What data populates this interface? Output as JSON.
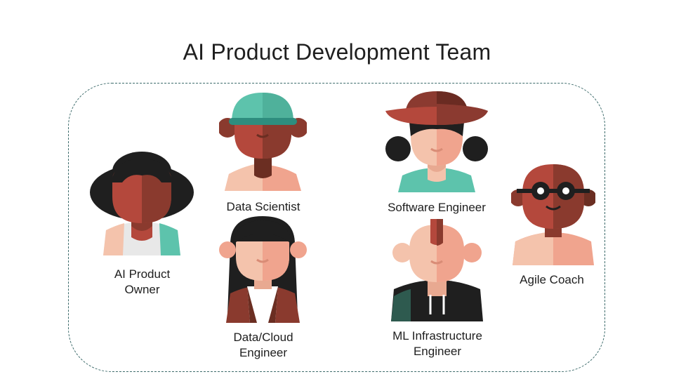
{
  "title": "AI Product Development Team",
  "team": {
    "members": [
      {
        "id": "ai-product-owner",
        "label_lines": [
          "AI Product",
          "Owner"
        ],
        "icon": "woman-bun-avatar-icon"
      },
      {
        "id": "data-scientist",
        "label_lines": [
          "Data Scientist"
        ],
        "icon": "cap-avatar-icon"
      },
      {
        "id": "data-cloud-engineer",
        "label_lines": [
          "Data/Cloud",
          "Engineer"
        ],
        "icon": "long-hair-avatar-icon"
      },
      {
        "id": "software-engineer",
        "label_lines": [
          "Software Engineer"
        ],
        "icon": "sun-hat-avatar-icon"
      },
      {
        "id": "ml-infrastructure-engineer",
        "label_lines": [
          "ML Infrastructure",
          "Engineer"
        ],
        "icon": "mohawk-avatar-icon"
      },
      {
        "id": "agile-coach",
        "label_lines": [
          "Agile Coach"
        ],
        "icon": "bald-glasses-avatar-icon"
      }
    ]
  },
  "colors": {
    "skin_light": "#f4c3ac",
    "skin_light_dark": "#e8a991",
    "skin_medium": "#b4483c",
    "skin_medium_dark": "#8a3a2e",
    "skin_dark_shadow": "#6b2e22",
    "hair_black": "#1f1f1f",
    "teal": "#5dc3ac",
    "teal_dark": "#2e8d7e",
    "salmon": "#f0a48e",
    "hat_brown": "#8b3a30",
    "hat_brown_dark": "#6a2b22",
    "frame": "#3d6b6b"
  }
}
